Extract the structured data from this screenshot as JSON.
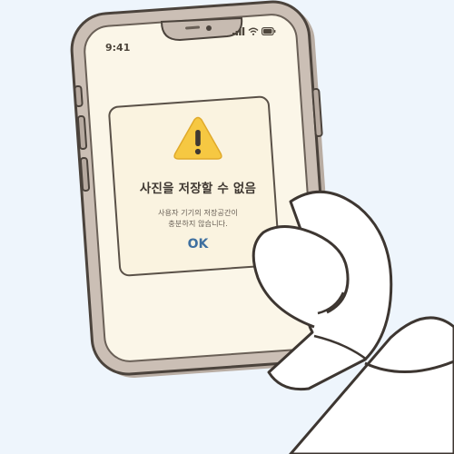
{
  "status_bar": {
    "time": "9:41",
    "icons": [
      "signal-icon",
      "wifi-icon",
      "battery-icon"
    ]
  },
  "dialog": {
    "icon": "warning-icon",
    "title": "사진을 저장할 수 없음",
    "message_lines": [
      "사용자 기기의 저장공간이",
      "충분하지 않습니다."
    ],
    "ok_label": "OK"
  },
  "colors": {
    "background": "#eef5fc",
    "phone_frame": "#c7bbb1",
    "screen": "#fbf6e8",
    "warning": "#f6c842",
    "ok_text": "#3f70a0",
    "title_text": "#3f3832"
  }
}
